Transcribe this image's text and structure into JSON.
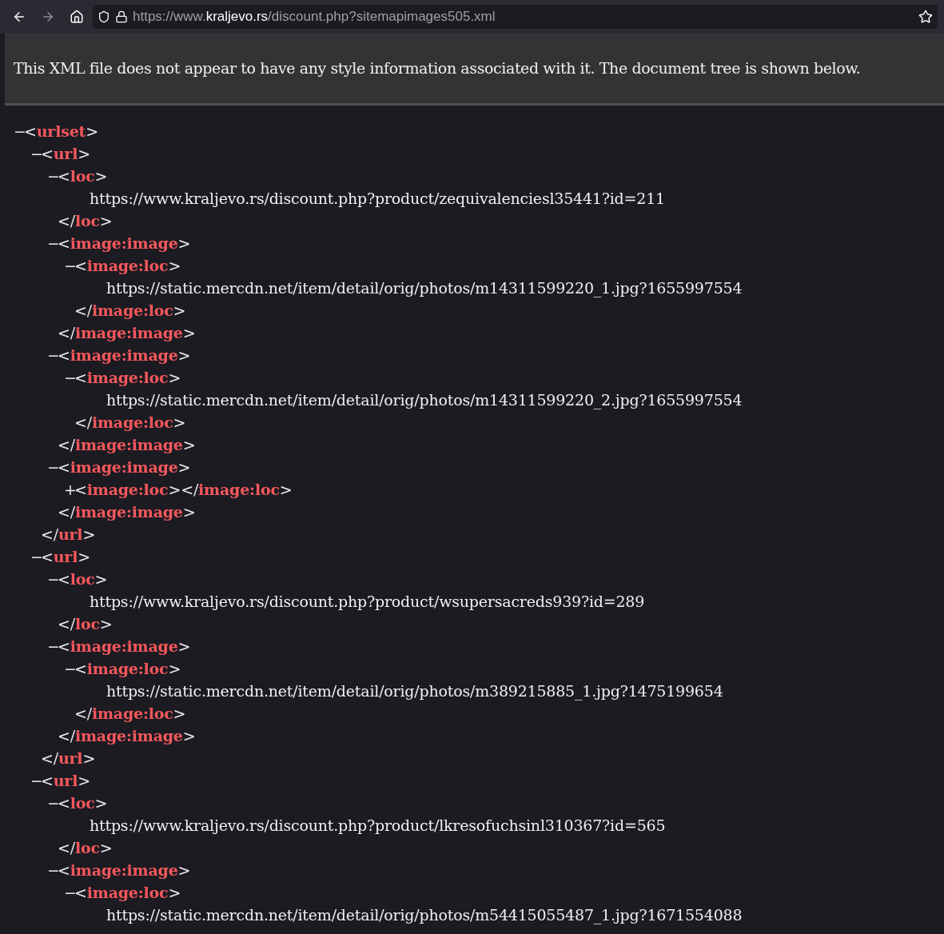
{
  "browser": {
    "url_host_prefix": "https://www.",
    "url_host": "kraljevo.rs",
    "url_path": "/discount.php?sitemapimages505.xml"
  },
  "notice": "This XML file does not appear to have any style information associated with it. The document tree is shown below.",
  "tree": [
    {
      "kind": "element",
      "toggle": "−",
      "open": [
        "<",
        "urlset",
        ">"
      ],
      "children": [
        {
          "kind": "element",
          "toggle": "−",
          "open": [
            "<",
            "url",
            ">"
          ],
          "close": [
            "</",
            "url",
            ">"
          ],
          "children": [
            {
              "kind": "element",
              "toggle": "−",
              "open": [
                "<",
                "loc",
                ">"
              ],
              "close": [
                "</",
                "loc",
                ">"
              ],
              "children": [
                {
                  "kind": "text",
                  "text": "https://www.kraljevo.rs/discount.php?product/zequivalenciesl35441?id=211"
                }
              ]
            },
            {
              "kind": "element",
              "toggle": "−",
              "open": [
                "<",
                "image:image",
                ">"
              ],
              "close": [
                "</",
                "image:image",
                ">"
              ],
              "children": [
                {
                  "kind": "element",
                  "toggle": "−",
                  "open": [
                    "<",
                    "image:loc",
                    ">"
                  ],
                  "close": [
                    "</",
                    "image:loc",
                    ">"
                  ],
                  "children": [
                    {
                      "kind": "text",
                      "text": "https://static.mercdn.net/item/detail/orig/photos/m14311599220_1.jpg?1655997554"
                    }
                  ]
                }
              ]
            },
            {
              "kind": "element",
              "toggle": "−",
              "open": [
                "<",
                "image:image",
                ">"
              ],
              "close": [
                "</",
                "image:image",
                ">"
              ],
              "children": [
                {
                  "kind": "element",
                  "toggle": "−",
                  "open": [
                    "<",
                    "image:loc",
                    ">"
                  ],
                  "close": [
                    "</",
                    "image:loc",
                    ">"
                  ],
                  "children": [
                    {
                      "kind": "text",
                      "text": "https://static.mercdn.net/item/detail/orig/photos/m14311599220_2.jpg?1655997554"
                    }
                  ]
                }
              ]
            },
            {
              "kind": "element",
              "toggle": "−",
              "open": [
                "<",
                "image:image",
                ">"
              ],
              "close": [
                "</",
                "image:image",
                ">"
              ],
              "children": [
                {
                  "kind": "element",
                  "toggle": "+",
                  "open": [
                    "<",
                    "image:loc",
                    ">"
                  ],
                  "close": [
                    "</",
                    "image:loc",
                    ">"
                  ]
                }
              ]
            }
          ]
        },
        {
          "kind": "element",
          "toggle": "−",
          "open": [
            "<",
            "url",
            ">"
          ],
          "close": [
            "</",
            "url",
            ">"
          ],
          "children": [
            {
              "kind": "element",
              "toggle": "−",
              "open": [
                "<",
                "loc",
                ">"
              ],
              "close": [
                "</",
                "loc",
                ">"
              ],
              "children": [
                {
                  "kind": "text",
                  "text": "https://www.kraljevo.rs/discount.php?product/wsupersacreds939?id=289"
                }
              ]
            },
            {
              "kind": "element",
              "toggle": "−",
              "open": [
                "<",
                "image:image",
                ">"
              ],
              "close": [
                "</",
                "image:image",
                ">"
              ],
              "children": [
                {
                  "kind": "element",
                  "toggle": "−",
                  "open": [
                    "<",
                    "image:loc",
                    ">"
                  ],
                  "close": [
                    "</",
                    "image:loc",
                    ">"
                  ],
                  "children": [
                    {
                      "kind": "text",
                      "text": "https://static.mercdn.net/item/detail/orig/photos/m389215885_1.jpg?1475199654"
                    }
                  ]
                }
              ]
            }
          ]
        },
        {
          "kind": "element",
          "toggle": "−",
          "open": [
            "<",
            "url",
            ">"
          ],
          "children": [
            {
              "kind": "element",
              "toggle": "−",
              "open": [
                "<",
                "loc",
                ">"
              ],
              "close": [
                "</",
                "loc",
                ">"
              ],
              "children": [
                {
                  "kind": "text",
                  "text": "https://www.kraljevo.rs/discount.php?product/lkresofuchsinl310367?id=565"
                }
              ]
            },
            {
              "kind": "element",
              "toggle": "−",
              "open": [
                "<",
                "image:image",
                ">"
              ],
              "children": [
                {
                  "kind": "element",
                  "toggle": "−",
                  "open": [
                    "<",
                    "image:loc",
                    ">"
                  ],
                  "children": [
                    {
                      "kind": "text",
                      "text": "https://static.mercdn.net/item/detail/orig/photos/m54415055487_1.jpg?1671554088"
                    }
                  ]
                }
              ]
            }
          ]
        }
      ]
    }
  ]
}
